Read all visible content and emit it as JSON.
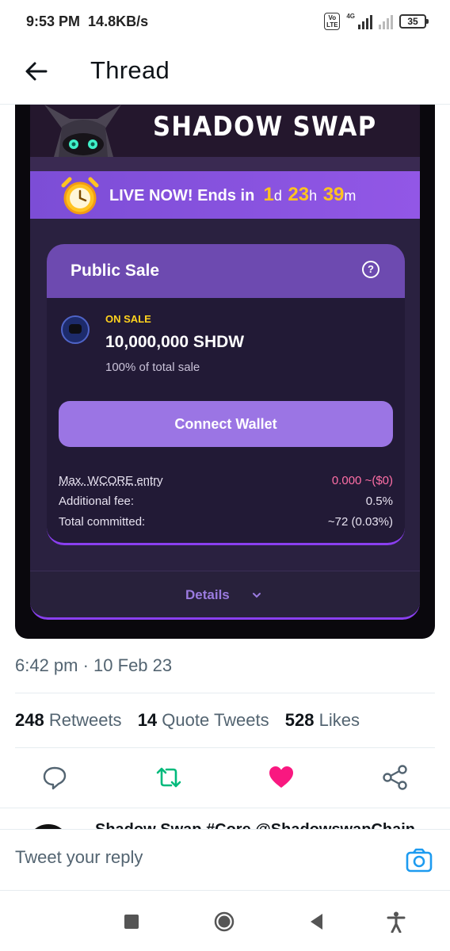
{
  "status_bar": {
    "time": "9:53 PM",
    "speed": "14.8KB/s",
    "volte": "Vo LTE",
    "network": "4G",
    "battery": "35"
  },
  "header": {
    "title": "Thread",
    "back_icon": "arrow-left-icon"
  },
  "media": {
    "banner_title": "SHADOW SWAP",
    "live": {
      "prefix": "LIVE NOW! Ends in",
      "days": "1",
      "days_unit": "d",
      "hours": "23",
      "hours_unit": "h",
      "minutes": "39",
      "minutes_unit": "m"
    },
    "sale": {
      "title": "Public Sale",
      "help_icon": "question-circle-icon",
      "status": "ON SALE",
      "amount": "10,000,000 SHDW",
      "share": "100% of total sale",
      "connect_label": "Connect Wallet",
      "rows": [
        {
          "label": "Max. WCORE entry",
          "value": "0.000 ~($0)"
        },
        {
          "label": "Additional fee:",
          "value": "0.5%"
        },
        {
          "label": "Total committed:",
          "value": "~72 (0.03%)"
        }
      ]
    },
    "details_label": "Details"
  },
  "tweet": {
    "timestamp": "6:42 pm · 10 Feb 23",
    "retweets_count": "248",
    "retweets_label": "Retweets",
    "quotes_count": "14",
    "quotes_label": "Quote Tweets",
    "likes_count": "528",
    "likes_label": "Likes",
    "action_icons": [
      "reply-icon",
      "retweet-icon",
      "like-icon",
      "share-icon"
    ]
  },
  "next_tweet_peek": "Shadow Swap #Core  @ShadowswapChain",
  "reply": {
    "placeholder": "Tweet your reply",
    "camera_icon": "camera-icon"
  },
  "colors": {
    "accent": "#1d9bf0",
    "retweet_green": "#00ba7c",
    "like_red": "#f91880",
    "sale_purple": "#9257e6",
    "countdown_yellow": "#ffc321"
  },
  "nav": [
    "recents-icon",
    "home-icon",
    "back-icon",
    "accessibility-icon"
  ]
}
